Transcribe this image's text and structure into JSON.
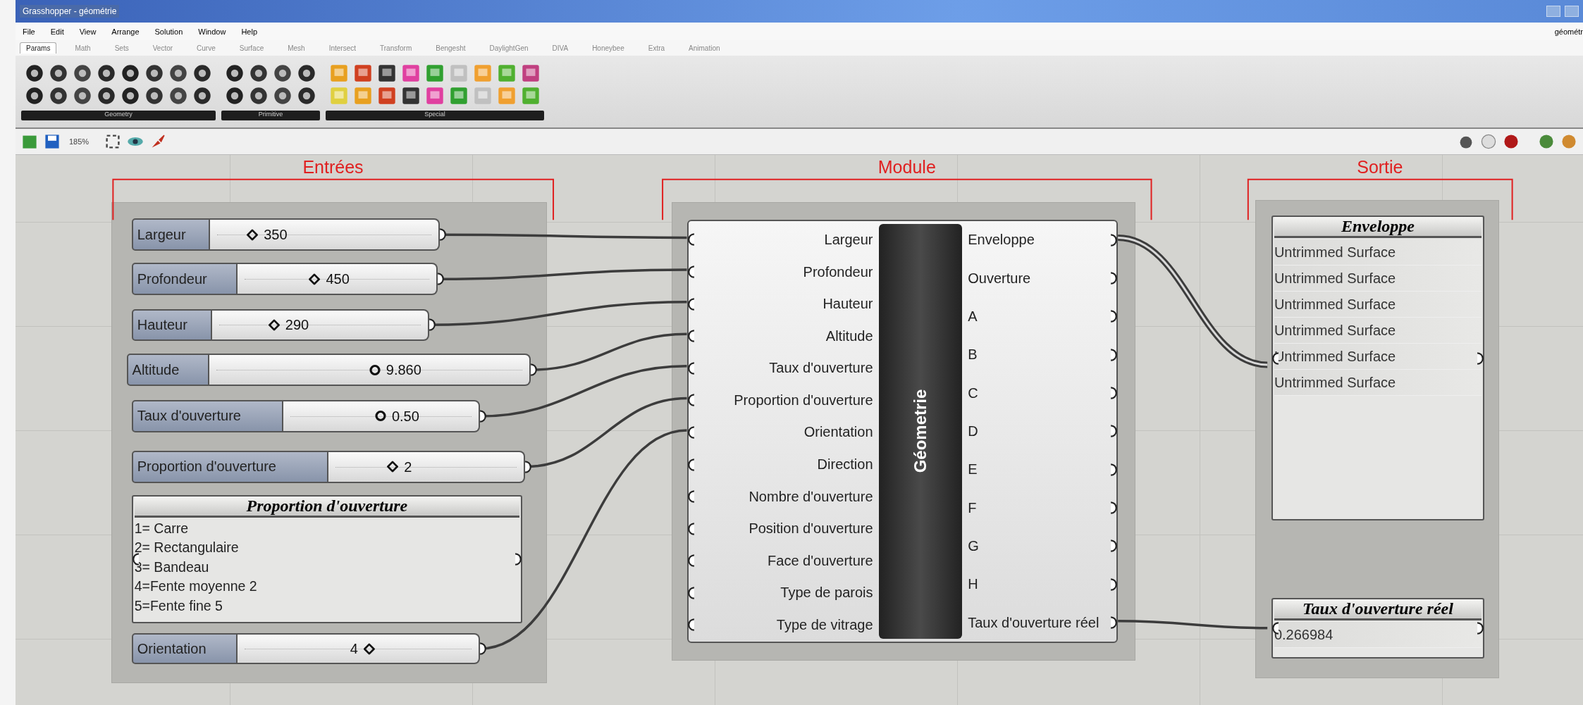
{
  "window": {
    "title": "Grasshopper - géométrie"
  },
  "menu": [
    "File",
    "Edit",
    "View",
    "Arrange",
    "Solution",
    "Window",
    "Help"
  ],
  "document_name": "géométr",
  "ribbon_tabs": [
    {
      "label": "Params",
      "selected": true
    },
    {
      "label": "Math",
      "selected": false
    },
    {
      "label": "Sets",
      "selected": false
    },
    {
      "label": "Vector",
      "selected": false
    },
    {
      "label": "Curve",
      "selected": false
    },
    {
      "label": "Surface",
      "selected": false
    },
    {
      "label": "Mesh",
      "selected": false
    },
    {
      "label": "Intersect",
      "selected": false
    },
    {
      "label": "Transform",
      "selected": false
    },
    {
      "label": "Bengesht",
      "selected": false
    },
    {
      "label": "DaylightGen",
      "selected": false
    },
    {
      "label": "DIVA",
      "selected": false
    },
    {
      "label": "Honeybee",
      "selected": false
    },
    {
      "label": "Extra",
      "selected": false
    },
    {
      "label": "Animation",
      "selected": false
    }
  ],
  "ribbon_panels": [
    {
      "label": "Geometry"
    },
    {
      "label": "Primitive"
    },
    {
      "label": "Special"
    }
  ],
  "zoom": "185%",
  "groups": [
    {
      "label": "Entrées"
    },
    {
      "label": "Module"
    },
    {
      "label": "Sortie"
    }
  ],
  "inputs": [
    {
      "kind": "integer_slider",
      "label": "Largeur",
      "value": "350",
      "level": 0.16
    },
    {
      "kind": "integer_slider",
      "label": "Profondeur",
      "value": "450",
      "level": 0.36
    },
    {
      "kind": "integer_slider",
      "label": "Hauteur",
      "value": "290",
      "level": 0.26
    },
    {
      "kind": "float_slider",
      "label": "Altitude",
      "value": "9.860",
      "level": 0.5
    },
    {
      "kind": "float_slider",
      "label": "Taux d'ouverture",
      "value": "0.50",
      "level": 0.47
    },
    {
      "kind": "integer_slider",
      "label": "Proportion d'ouverture",
      "value": "2",
      "level": 0.3
    },
    {
      "kind": "panel",
      "title": "Proportion d'ouverture",
      "lines": [
        "1= Carre",
        "2= Rectangulaire",
        "3= Bandeau",
        "4=Fente moyenne 2",
        "5=Fente fine 5"
      ]
    },
    {
      "kind": "integer_slider",
      "label": "Orientation",
      "value": "4",
      "level": 0.57
    }
  ],
  "module": {
    "title": "Géometrie",
    "inputs": [
      "Largeur",
      "Profondeur",
      "Hauteur",
      "Altitude",
      "Taux d'ouverture",
      "Proportion d'ouverture",
      "Orientation",
      "Direction",
      "Nombre d'ouverture",
      "Position d'ouverture",
      "Face d'ouverture",
      "Type de parois",
      "Type de vitrage"
    ],
    "outputs": [
      "Enveloppe",
      "Ouverture",
      "A",
      "B",
      "C",
      "D",
      "E",
      "F",
      "G",
      "H",
      "Taux d'ouverture réel"
    ]
  },
  "outputs": [
    {
      "title": "Enveloppe",
      "lines": [
        "Untrimmed Surface",
        "Untrimmed Surface",
        "Untrimmed Surface",
        "Untrimmed Surface",
        "Untrimmed Surface",
        "Untrimmed Surface"
      ]
    },
    {
      "title": "Taux d'ouverture réel",
      "lines": [
        "0.266984"
      ]
    }
  ]
}
